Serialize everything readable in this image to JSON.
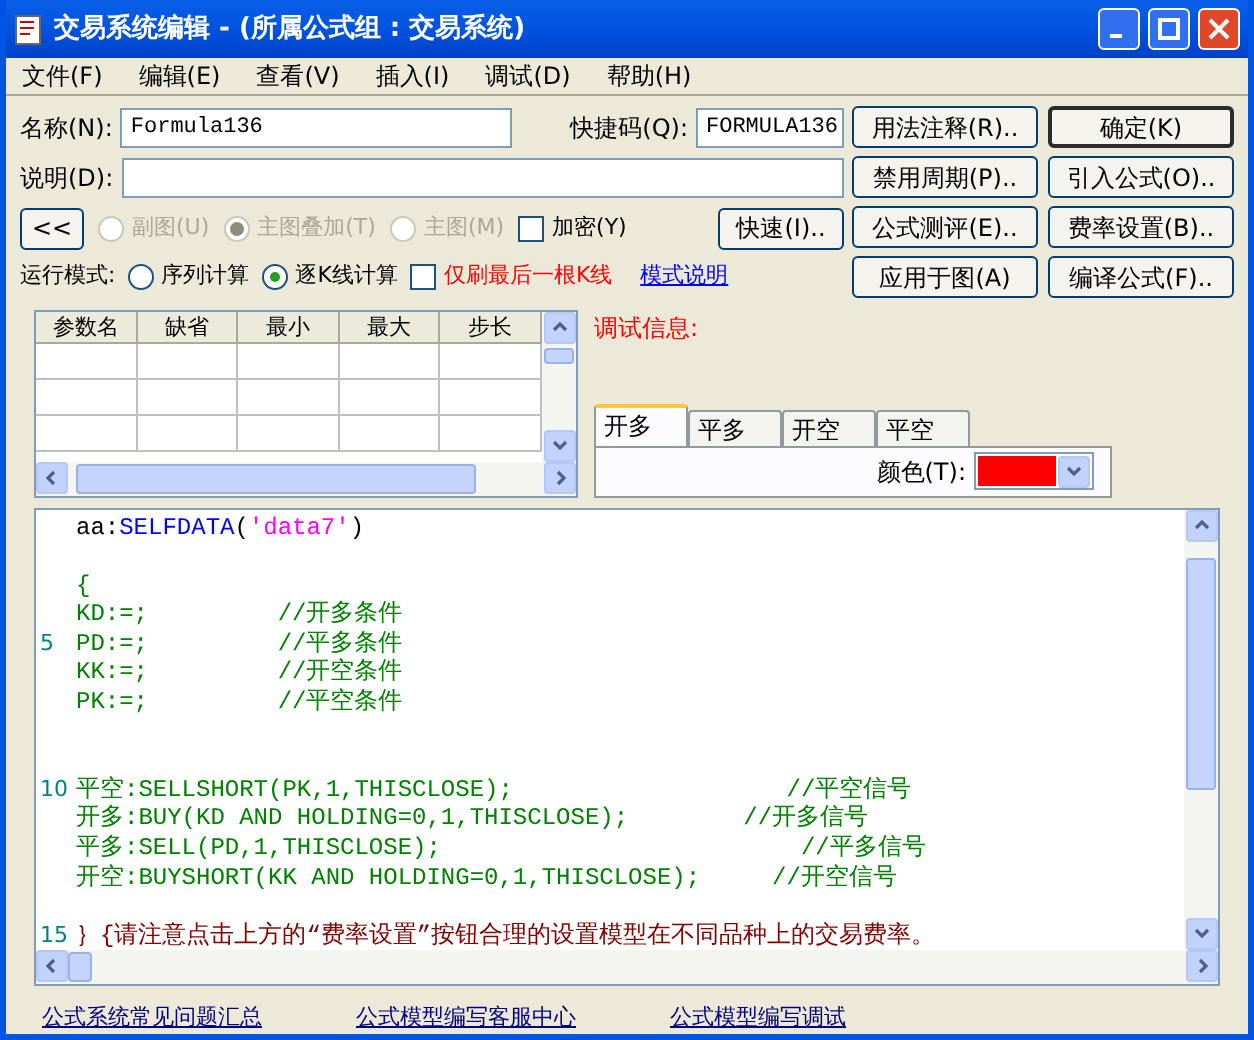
{
  "window": {
    "title": "交易系统编辑 - (所属公式组 : 交易系统)"
  },
  "menu": [
    {
      "label": "文件(F)"
    },
    {
      "label": "编辑(E)"
    },
    {
      "label": "查看(V)"
    },
    {
      "label": "插入(I)"
    },
    {
      "label": "调试(D)"
    },
    {
      "label": "帮助(H)"
    }
  ],
  "form": {
    "name_label": "名称(N):",
    "name_value": "Formula136",
    "shortcut_label": "快捷码(Q):",
    "shortcut_value": "FORMULA136",
    "desc_label": "说明(D):",
    "collapse_button": "<<",
    "chart_options": [
      {
        "label": "副图(U)",
        "selected": false,
        "disabled": true
      },
      {
        "label": "主图叠加(T)",
        "selected": true,
        "disabled": true
      },
      {
        "label": "主图(M)",
        "selected": false,
        "disabled": true
      }
    ],
    "encrypt": {
      "label": "加密(Y)",
      "checked": false
    },
    "quick_button": "快速(I)..",
    "run_mode_label": "运行模式:",
    "run_modes": [
      {
        "label": "序列计算",
        "selected": false
      },
      {
        "label": "逐K线计算",
        "selected": true
      }
    ],
    "refresh_last": {
      "label": "仅刷最后一根K线",
      "checked": false
    },
    "mode_help_link": "模式说明"
  },
  "buttons": [
    {
      "label": "用法注释(R)..",
      "default": false
    },
    {
      "label": "确定(K)",
      "default": true
    },
    {
      "label": "禁用周期(P)..",
      "default": false
    },
    {
      "label": "引入公式(O)..",
      "default": false
    },
    {
      "label": "公式测评(E)..",
      "default": false
    },
    {
      "label": "费率设置(B)..",
      "default": false
    },
    {
      "label": "应用于图(A)",
      "default": false
    },
    {
      "label": "编译公式(F)..",
      "default": false
    }
  ],
  "params_table": {
    "columns": [
      "参数名",
      "缺省",
      "最小",
      "最大",
      "步长"
    ]
  },
  "debug_label": "调试信息:",
  "signal_tabs": [
    {
      "label": "开多",
      "selected": true
    },
    {
      "label": "平多",
      "selected": false
    },
    {
      "label": "开空",
      "selected": false
    },
    {
      "label": "平空",
      "selected": false
    }
  ],
  "color_picker": {
    "label": "颜色(T):",
    "color": "#ff0000"
  },
  "editor": {
    "lines": [
      {
        "kind": "code",
        "segments": [
          {
            "text": "aa:",
            "color": "#000000"
          },
          {
            "text": "SELFDATA",
            "color": "#0000ff"
          },
          {
            "text": "(",
            "color": "#000000"
          },
          {
            "text": "'data7'",
            "color": "#ff00ff"
          },
          {
            "text": ")",
            "color": "#000000"
          }
        ]
      },
      {
        "kind": "blank"
      },
      {
        "kind": "code",
        "segments": [
          {
            "text": "{",
            "color": "#008000"
          }
        ]
      },
      {
        "kind": "code",
        "segments": [
          {
            "text": "KD:=;         //开多条件",
            "color": "#008000"
          }
        ]
      },
      {
        "kind": "code",
        "number": "5",
        "segments": [
          {
            "text": "PD:=;         //平多条件",
            "color": "#008000"
          }
        ]
      },
      {
        "kind": "code",
        "segments": [
          {
            "text": "KK:=;         //开空条件",
            "color": "#008000"
          }
        ]
      },
      {
        "kind": "code",
        "segments": [
          {
            "text": "PK:=;         //平空条件",
            "color": "#008000"
          }
        ]
      },
      {
        "kind": "blank"
      },
      {
        "kind": "blank"
      },
      {
        "kind": "code",
        "number": "10",
        "segments": [
          {
            "text": "平空:SELLSHORT(PK,1,THISCLOSE);                   //平空信号",
            "color": "#008000"
          }
        ]
      },
      {
        "kind": "code",
        "segments": [
          {
            "text": "开多:BUY(KD AND HOLDING=0,1,THISCLOSE);        //开多信号",
            "color": "#008000"
          }
        ]
      },
      {
        "kind": "code",
        "segments": [
          {
            "text": "平多:SELL(PD,1,THISCLOSE);                         //平多信号",
            "color": "#008000"
          }
        ]
      },
      {
        "kind": "code",
        "segments": [
          {
            "text": "开空:BUYSHORT(KK AND HOLDING=0,1,THISCLOSE);     //开空信号",
            "color": "#008000"
          }
        ]
      },
      {
        "kind": "blank"
      },
      {
        "kind": "code",
        "number": "15",
        "segments": [
          {
            "text": "｝{请注意点击上方的“费率设置”按钮合理的设置模型在不同品种上的交易费率。",
            "color": "#800000"
          }
        ]
      }
    ]
  },
  "footer_links": [
    "公式系统常见问题汇总",
    "公式模型编写客服中心",
    "公式模型编写调试"
  ]
}
